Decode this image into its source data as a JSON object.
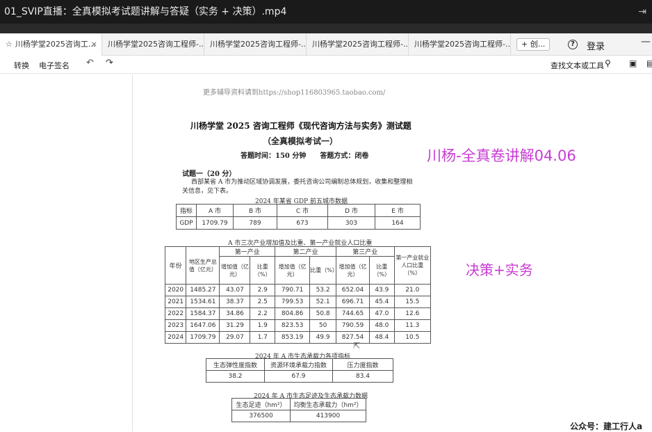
{
  "video": {
    "title": "01_SVIP直播：全真模拟考试题讲解与答疑（实务 + 决策）.mp4",
    "pin_icon": "pin-icon"
  },
  "browser": {
    "tabs": [
      {
        "label": "川杨学堂2025咨询工...",
        "active": true
      },
      {
        "label": "川杨学堂2025咨询工程师-..."
      },
      {
        "label": "川杨学堂2025咨询工程师-..."
      },
      {
        "label": "川杨学堂2025咨询工程师-..."
      },
      {
        "label": "川杨学堂2025咨询工程师-..."
      }
    ],
    "new_tab_label": "+ 创...",
    "login_label": "登录"
  },
  "toolbar": {
    "convert_label": "转换",
    "sign_label": "电子签名",
    "find_label": "查找文本或工具"
  },
  "document": {
    "ad_line": "更多辅导资料请到https://shop116803965.taobao.com/",
    "title": "川杨学堂 2025 咨询工程师《现代咨询方法与实务》测试题",
    "subtitle": "（全真模拟考试一）",
    "exam_time": "答题时间：150 分钟　　答题方式：闭卷",
    "question1": "试题一（20 分）",
    "intro_line1": "西部某省 A 市为推动区域协调发展，委托咨询公司编制总体规划，收集和整理相",
    "intro_line2": "关信息，见下表。",
    "gdp_table": {
      "caption": "2024 年某省 GDP 前五城市数据",
      "header": [
        "指标",
        "A 市",
        "B 市",
        "C 市",
        "D 市",
        "E 市"
      ],
      "row": [
        "GDP",
        "1709.79",
        "789",
        "673",
        "303",
        "164"
      ]
    },
    "industry_table": {
      "caption": "A 市三次产业增加值及比重、第一产业就业人口比重",
      "h_year": "年份",
      "h_gdp": "地区生产总值（亿元）",
      "h_primary": "第一产业",
      "h_secondary": "第二产业",
      "h_tertiary": "第三产业",
      "h_employment": "第一产业就业人口比重（%）",
      "h_added": "增加值（亿元）",
      "h_ratio": "比重（%）",
      "rows": [
        [
          "2020",
          "1485.27",
          "43.07",
          "2.9",
          "790.71",
          "53.2",
          "652.04",
          "43.9",
          "21.0"
        ],
        [
          "2021",
          "1534.61",
          "38.37",
          "2.5",
          "799.53",
          "52.1",
          "696.71",
          "45.4",
          "15.5"
        ],
        [
          "2022",
          "1584.37",
          "34.86",
          "2.2",
          "804.86",
          "50.8",
          "744.65",
          "47.0",
          "12.6"
        ],
        [
          "2023",
          "1647.06",
          "31.29",
          "1.9",
          "823.53",
          "50",
          "790.59",
          "48.0",
          "11.3"
        ],
        [
          "2024",
          "1709.79",
          "29.07",
          "1.7",
          "853.19",
          "49.9",
          "827.54",
          "48.4",
          "10.5"
        ]
      ]
    },
    "eco_index_table": {
      "caption": "2024 年 A 市生态承载力各项指标",
      "header": [
        "生态弹性度指数",
        "资源环境承载力指数",
        "压力度指数"
      ],
      "row": [
        "38.2",
        "67.9",
        "83.4"
      ]
    },
    "eco_footprint_table": {
      "caption": "2024 年 A 市生态足迹及生态承载力数据",
      "header": [
        "生态足迹（hm²）",
        "均衡生态承载力（hm²）"
      ],
      "row": [
        "376500",
        "413900"
      ]
    }
  },
  "overlays": {
    "lecture_label": "川杨-全真卷讲解04.06",
    "topic_label": "决策+实务",
    "watermark": "公众号：建工行人a"
  }
}
